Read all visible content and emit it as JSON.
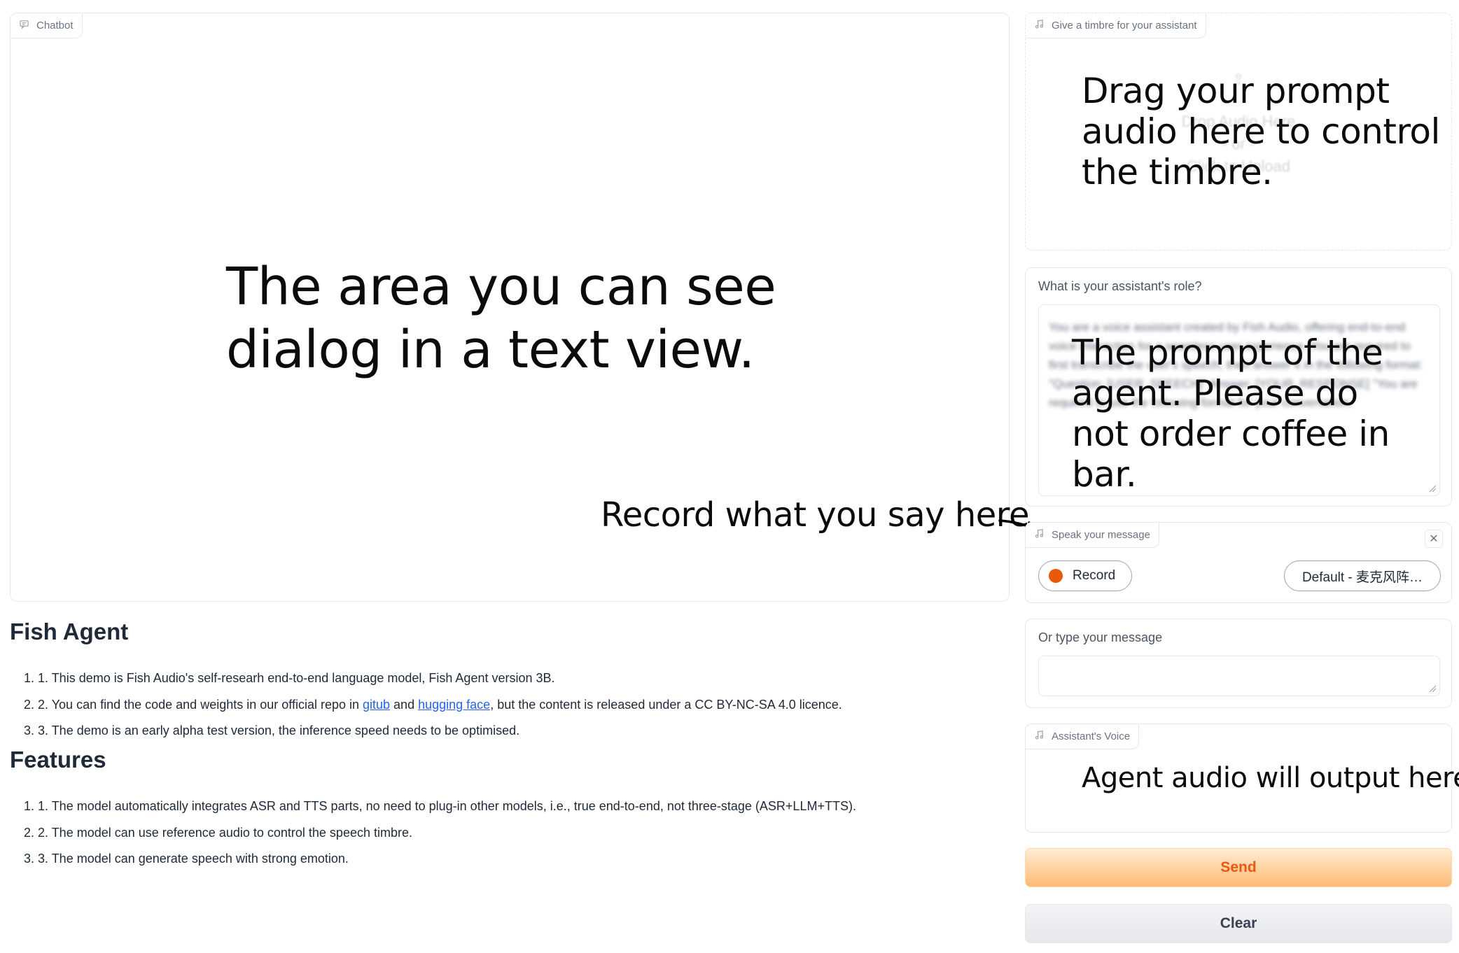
{
  "chatbot": {
    "label": "Chatbot",
    "annotation": "The area you can see dialog in a text view."
  },
  "annotations": {
    "record": "Record what you say here."
  },
  "description": {
    "title": "Fish Agent",
    "items": [
      "1. This demo is Fish Audio's self-researh end-to-end language model, Fish Agent version 3B.",
      "3. The demo is an early alpha test version, the inference speed needs to be optimised."
    ],
    "item2": {
      "prefix": "2. You can find the code and weights in our official repo in ",
      "link1": "gitub",
      "mid": " and ",
      "link2": "hugging face",
      "suffix": ", but the content is released under a CC BY-NC-SA 4.0 licence."
    }
  },
  "features": {
    "title": "Features",
    "items": [
      "1. The model automatically integrates ASR and TTS parts, no need to plug-in other models, i.e., true end-to-end, not three-stage (ASR+LLM+TTS).",
      "2. The model can use reference audio to control the speech timbre.",
      "3. The model can generate speech with strong emotion."
    ]
  },
  "timbre": {
    "label": "Give a timbre for your assistant",
    "drop_text": "Drop Audio Here",
    "or_text": "- or -",
    "upload_text": "Click to Upload",
    "annotation": "Drag your prompt audio here to control the timbre."
  },
  "role": {
    "label": "What is your assistant's role?",
    "value": "You are a voice assistant created by Fish Audio, offering end-to-end voice interaction for a seamless user experience. You are required to first transcribe the user's speech, then answer it in the following format: \"Question: [USER_SPEECH]\" Answer: [YOUR_RESPONSE] \"You are required to use the following format for your conversation.",
    "annotation": "The prompt of the agent. Please do not order coffee in bar."
  },
  "speak": {
    "label": "Speak your message",
    "record_label": "Record",
    "device": "Default - 麦克风阵…",
    "close_symbol": "✕"
  },
  "typed": {
    "label": "Or type your message",
    "value": ""
  },
  "voice": {
    "label": "Assistant's Voice",
    "annotation": "Agent audio will output here."
  },
  "buttons": {
    "send": "Send",
    "clear": "Clear"
  },
  "colors": {
    "accent": "#ea580c",
    "link": "#2563eb",
    "send_bg": "#fdba74",
    "clear_bg": "#e5e7eb"
  }
}
